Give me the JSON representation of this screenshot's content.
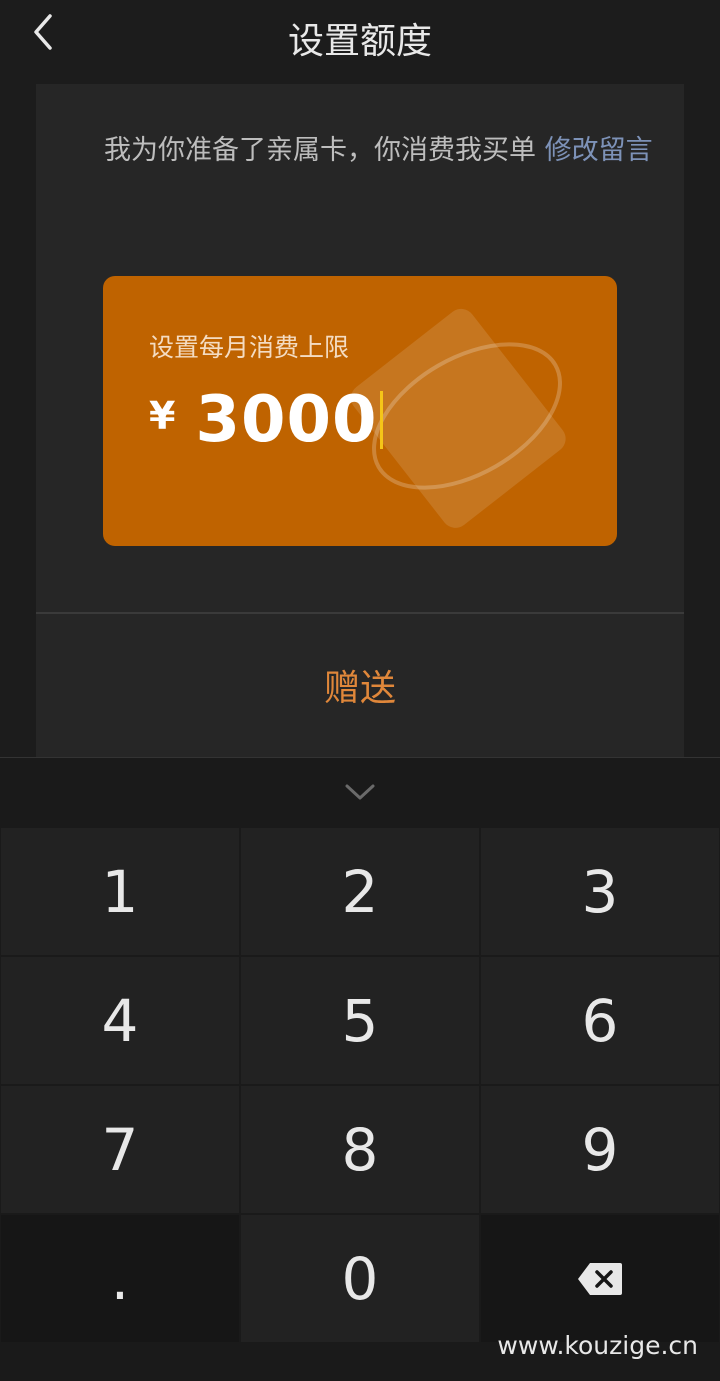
{
  "header": {
    "title": "设置额度"
  },
  "message": {
    "text": "我为你准备了亲属卡，你消费我买单 ",
    "edit_link": "修改留言"
  },
  "card": {
    "label": "设置每月消费上限",
    "currency": "¥",
    "amount": "3000"
  },
  "action": {
    "gift_label": "赠送"
  },
  "keyboard": {
    "keys": [
      "1",
      "2",
      "3",
      "4",
      "5",
      "6",
      "7",
      "8",
      "9",
      ".",
      "0"
    ],
    "delete_icon": "backspace-icon",
    "collapse_icon": "chevron-down-icon"
  },
  "watermark": "www.kouzige.cn",
  "colors": {
    "accent": "#e0873a",
    "card": "#bf6300",
    "link": "#7d92b8",
    "caret": "#f5c518"
  }
}
